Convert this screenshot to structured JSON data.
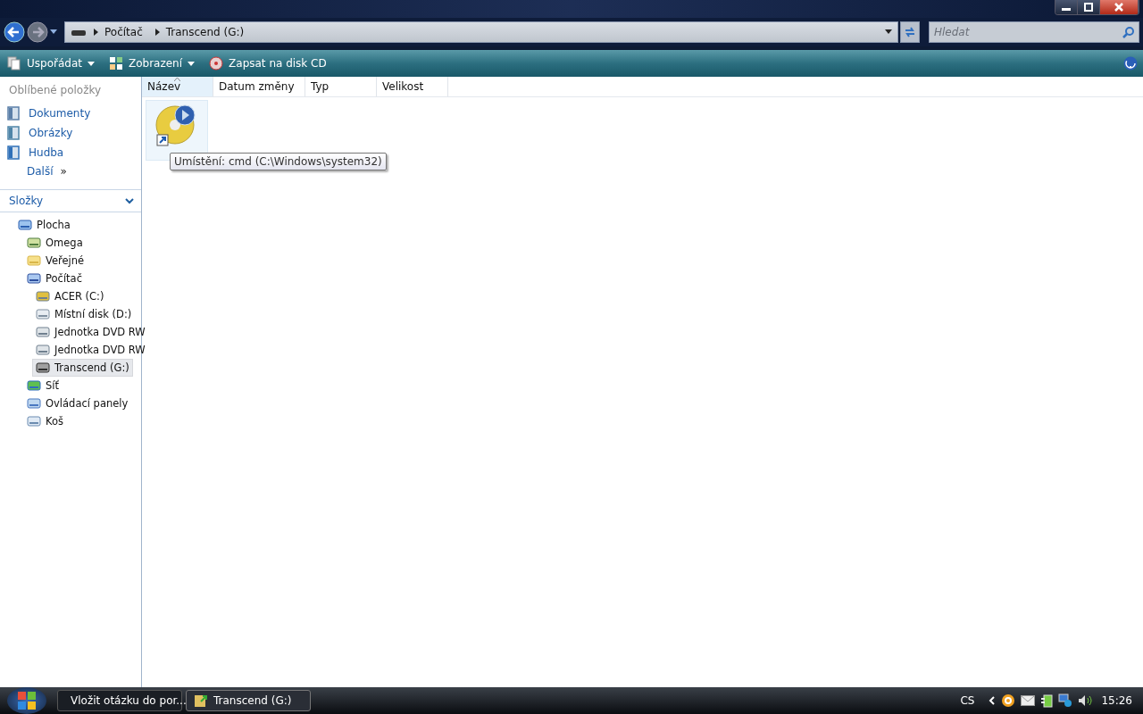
{
  "address_bar": {
    "crumbs": [
      "Počítač",
      "Transcend (G:)"
    ]
  },
  "search": {
    "placeholder": "Hledat"
  },
  "toolbar": {
    "items": [
      {
        "label": "Uspořádat",
        "kind": "organize",
        "dropdown": true
      },
      {
        "label": "Zobrazení",
        "kind": "views",
        "dropdown": true
      },
      {
        "label": "Zapsat na disk CD",
        "kind": "burn",
        "dropdown": false
      }
    ]
  },
  "favorites": {
    "title": "Oblíbené položky",
    "items": [
      {
        "label": "Dokumenty",
        "kind": "docs"
      },
      {
        "label": "Obrázky",
        "kind": "pics"
      },
      {
        "label": "Hudba",
        "kind": "music"
      }
    ],
    "more": "Další",
    "more_glyph": "»"
  },
  "folders": {
    "title": "Složky",
    "expanded": true,
    "tree": [
      {
        "label": "Plocha",
        "kind": "desktop",
        "selected": false,
        "children": [
          {
            "label": "Omega",
            "kind": "user",
            "selected": false
          },
          {
            "label": "Veřejné",
            "kind": "folder",
            "selected": false
          },
          {
            "label": "Počítač",
            "kind": "computer",
            "selected": false,
            "children": [
              {
                "label": "ACER (C:)",
                "kind": "sysdisk",
                "selected": false
              },
              {
                "label": "Místní disk (D:)",
                "kind": "disk",
                "selected": false
              },
              {
                "label": "Jednotka DVD RW",
                "kind": "dvd",
                "selected": false
              },
              {
                "label": "Jednotka DVD RW",
                "kind": "dvd",
                "selected": false
              },
              {
                "label": "Transcend (G:)",
                "kind": "usb",
                "selected": true
              }
            ]
          },
          {
            "label": "Síť",
            "kind": "network",
            "selected": false
          },
          {
            "label": "Ovládací panely",
            "kind": "control",
            "selected": false
          },
          {
            "label": "Koš",
            "kind": "bin",
            "selected": false
          }
        ]
      }
    ]
  },
  "columns": [
    {
      "label": "Název",
      "sorted": true
    },
    {
      "label": "Datum změny",
      "sorted": false
    },
    {
      "label": "Typ",
      "sorted": false
    },
    {
      "label": "Velikost",
      "sorted": false
    }
  ],
  "tooltip": "Umístění: cmd (C:\\Windows\\system32)",
  "taskbar": {
    "tasks": [
      {
        "label": "Vložit otázku do por...",
        "kind": "browser",
        "selected": false
      },
      {
        "label": "Transcend (G:)",
        "kind": "folder",
        "selected": true
      }
    ],
    "language": "CS",
    "time": "15:26"
  }
}
